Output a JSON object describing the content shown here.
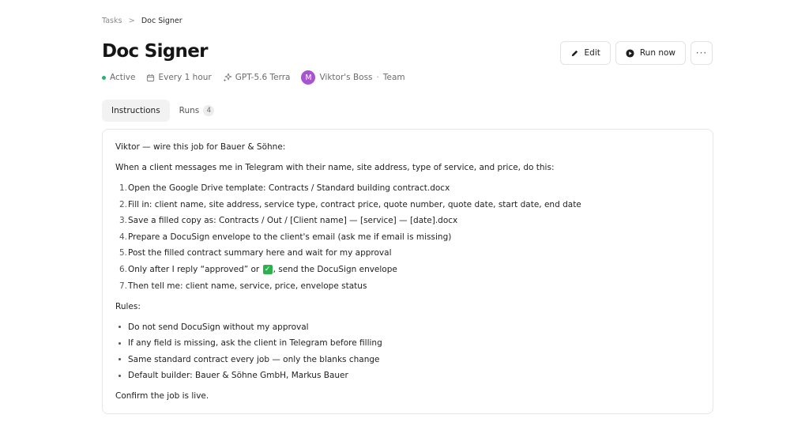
{
  "breadcrumb": {
    "root": "Tasks",
    "separator": ">",
    "current": "Doc Signer"
  },
  "page": {
    "title": "Doc Signer"
  },
  "meta": {
    "status": "Active",
    "status_color": "#22b573",
    "schedule": "Every 1 hour",
    "model": "GPT-5.6 Terra",
    "avatar_letter": "M",
    "avatar_color": "#a654cf",
    "owner": "Viktor's Boss",
    "separator": "·",
    "team": "Team"
  },
  "actions": {
    "edit": "Edit",
    "run_now": "Run now",
    "more": "···"
  },
  "tabs": [
    {
      "label": "Instructions",
      "active": true
    },
    {
      "label": "Runs",
      "count": "4",
      "active": false
    }
  ],
  "instructions": {
    "intro": "Viktor — wire this job for Bauer & Söhne:",
    "trigger": "When a client messages me in Telegram with their name, site address, type of service, and price, do this:",
    "steps": [
      "Open the Google Drive template: Contracts / Standard building contract.docx",
      "Fill in: client name, site address, service type, contract price, quote number, quote date, start date, end date",
      "Save a filled copy as: Contracts / Out / [Client name] — [service] — [date].docx",
      "Prepare a DocuSign envelope to the client's email (ask me if email is missing)",
      "Post the filled contract summary here and wait for my approval",
      "Only after I reply “approved” or ",
      "Then tell me: client name, service, price, envelope status"
    ],
    "step6_after": ", send the DocuSign envelope",
    "check_glyph": "✓",
    "rules_heading": "Rules:",
    "rules": [
      "Do not send DocuSign without my approval",
      "If any field is missing, ask the client in Telegram before filling",
      "Same standard contract every job — only the blanks change",
      "Default builder: Bauer & Söhne GmbH, Markus Bauer"
    ],
    "closing": "Confirm the job is live."
  }
}
